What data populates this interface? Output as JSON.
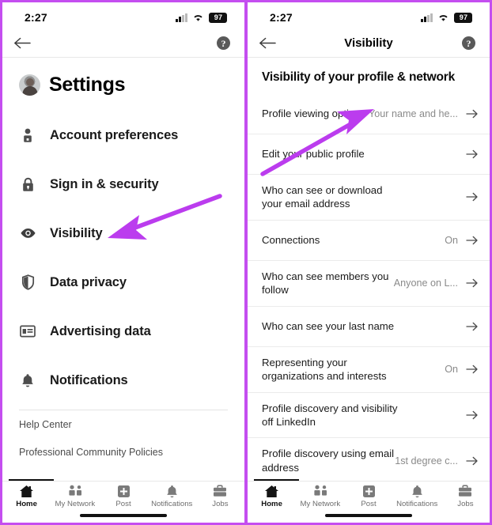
{
  "accent": {
    "frame_purple": "#c44ef0",
    "arrow_purple": "#bb3cee"
  },
  "status_bar": {
    "time": "2:27",
    "battery": "97",
    "wifi_icon": "wifi-icon",
    "signal_icon": "cellular-signal-icon"
  },
  "left_screen": {
    "topbar": {
      "back_icon": "back-arrow-icon",
      "help_icon": "help-question-icon",
      "title": ""
    },
    "header": {
      "title": "Settings",
      "avatar": "profile-avatar"
    },
    "menu": [
      {
        "label": "Account preferences",
        "icon": "person-icon"
      },
      {
        "label": "Sign in & security",
        "icon": "lock-icon"
      },
      {
        "label": "Visibility",
        "icon": "eye-icon"
      },
      {
        "label": "Data privacy",
        "icon": "shield-icon"
      },
      {
        "label": "Advertising data",
        "icon": "ad-card-icon"
      },
      {
        "label": "Notifications",
        "icon": "bell-icon"
      }
    ],
    "links": [
      {
        "label": "Help Center"
      },
      {
        "label": "Professional Community Policies"
      }
    ]
  },
  "right_screen": {
    "topbar": {
      "back_icon": "back-arrow-icon",
      "title": "Visibility",
      "help_icon": "help-question-icon"
    },
    "section_title": "Visibility of your profile & network",
    "rows": [
      {
        "label": "Profile viewing options",
        "value": "Your name and he..."
      },
      {
        "label": "Edit your public profile",
        "value": ""
      },
      {
        "label": "Who can see or download your email address",
        "value": ""
      },
      {
        "label": "Connections",
        "value": "On"
      },
      {
        "label": "Who can see members you follow",
        "value": "Anyone on L..."
      },
      {
        "label": "Who can see your last name",
        "value": ""
      },
      {
        "label": "Representing your organizations and interests",
        "value": "On"
      },
      {
        "label": "Profile discovery and visibility off LinkedIn",
        "value": ""
      },
      {
        "label": "Profile discovery using email address",
        "value": "1st degree c..."
      }
    ]
  },
  "bottom_nav": [
    {
      "label": "Home",
      "icon": "home-icon",
      "active": true
    },
    {
      "label": "My Network",
      "icon": "network-icon",
      "active": false
    },
    {
      "label": "Post",
      "icon": "plus-square-icon",
      "active": false
    },
    {
      "label": "Notifications",
      "icon": "bell-icon",
      "active": false
    },
    {
      "label": "Jobs",
      "icon": "briefcase-icon",
      "active": false
    }
  ]
}
